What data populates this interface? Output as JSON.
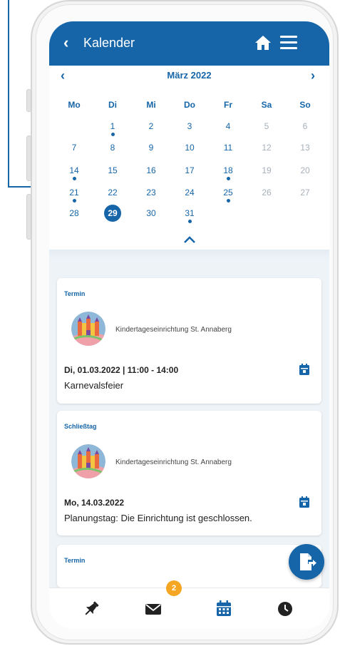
{
  "header": {
    "back_icon": "chevron-left-icon",
    "title": "Kalender",
    "home_icon": "home-icon",
    "menu_icon": "hamburger-menu-icon"
  },
  "calendar": {
    "month_label": "März 2022",
    "prev_icon": "chevron-left-icon",
    "next_icon": "chevron-right-icon",
    "weekdays": [
      "Mo",
      "Di",
      "Mi",
      "Do",
      "Fr",
      "Sa",
      "So"
    ],
    "days": [
      "1",
      "2",
      "3",
      "4",
      "5",
      "6",
      "7",
      "8",
      "9",
      "10",
      "11",
      "12",
      "13",
      "14",
      "15",
      "16",
      "17",
      "18",
      "19",
      "20",
      "21",
      "22",
      "23",
      "24",
      "25",
      "26",
      "27",
      "28",
      "29",
      "30",
      "31"
    ],
    "days_with_events": [
      "1",
      "14",
      "18",
      "21",
      "25",
      "31"
    ],
    "today": "29",
    "collapse_icon": "chevron-up-icon"
  },
  "cards": [
    {
      "category": "Termin",
      "organization": "Kindertageseinrichtung St. Annaberg",
      "datetime": "Di, 01.03.2022 | 11:00 - 14:00",
      "description": "Karnevalsfeier",
      "icon": "calendar-icon"
    },
    {
      "category": "Schließtag",
      "organization": "Kindertageseinrichtung St. Annaberg",
      "datetime": "Mo, 14.03.2022",
      "description": "Planungstag: Die Einrichtung ist geschlossen.",
      "icon": "calendar-icon"
    },
    {
      "category": "Termin"
    }
  ],
  "bottom_nav": {
    "items": [
      "pin-icon",
      "mail-icon",
      "calendar-icon",
      "clock-icon"
    ],
    "mail_badge": "2"
  },
  "fab": {
    "icon": "export-document-icon"
  },
  "colors": {
    "primary": "#1565a8",
    "badge": "#f5a623",
    "background": "#eef3f8"
  }
}
